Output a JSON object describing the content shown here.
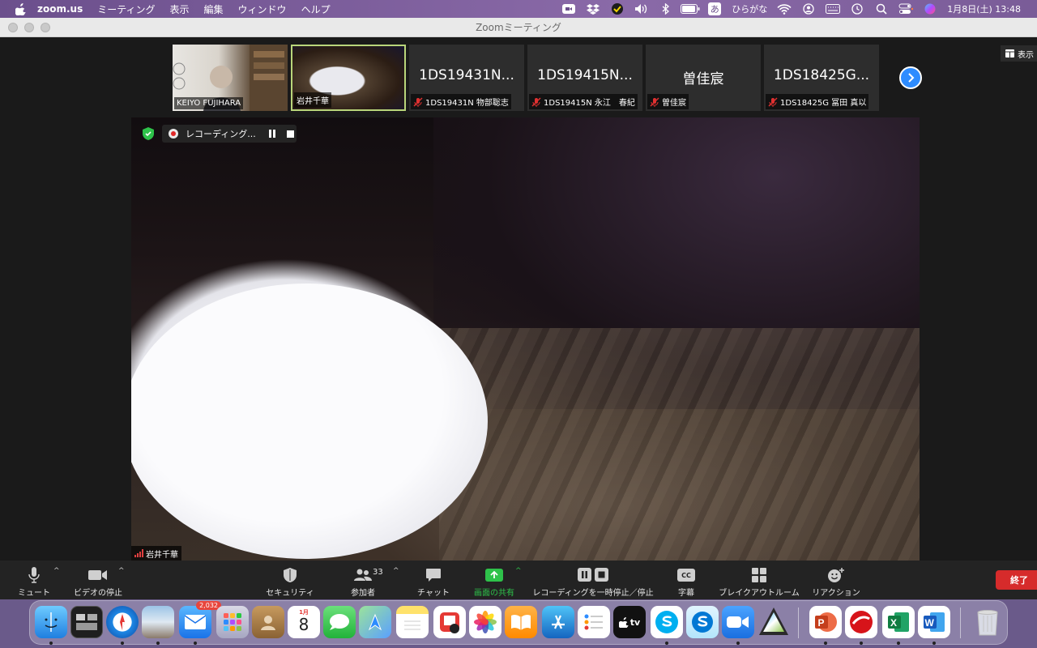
{
  "menubar": {
    "app": "zoom.us",
    "items": [
      "ミーティング",
      "表示",
      "編集",
      "ウィンドウ",
      "ヘルプ"
    ],
    "input_mode": "ひらがな",
    "input_badge": "あ",
    "datetime": "1月8日(土)  13:48"
  },
  "window": {
    "title": "Zoomミーティング"
  },
  "thumbnails": [
    {
      "name": "KEIYO FUJIHARA",
      "display": "",
      "muted": false
    },
    {
      "name": "岩井千華",
      "display": "",
      "muted": false
    },
    {
      "name": "1DS19431N 物部聡志",
      "display": "1DS19431N...",
      "muted": true
    },
    {
      "name": "1DS19415N 永江　春紀",
      "display": "1DS19415N...",
      "muted": true
    },
    {
      "name": "曽佳宸",
      "display": "曽佳宸",
      "muted": true
    },
    {
      "name": "1DS18425G 冨田 真以",
      "display": "1DS18425G...",
      "muted": true
    }
  ],
  "view_button": "表示",
  "recording": {
    "label": "レコーディング..."
  },
  "speaker": {
    "name": "岩井千華"
  },
  "toolbar": {
    "mute": "ミュート",
    "video": "ビデオの停止",
    "security": "セキュリティ",
    "participants": "参加者",
    "participants_count": "33",
    "chat": "チャット",
    "share": "画面の共有",
    "recording": "レコーディングを一時停止／停止",
    "captions": "字幕",
    "captions_icon": "CC",
    "breakout": "ブレイクアウトルーム",
    "reactions": "リアクション",
    "end": "終了"
  },
  "dock": {
    "mail_badge": "2,032",
    "calendar_month": "1月",
    "calendar_day": "8",
    "tv_label": "tv"
  },
  "colors": {
    "accent_blue": "#2d8cff",
    "share_green": "#2ec24a",
    "end_red": "#d62b2b",
    "active_border": "#b9d57a"
  }
}
